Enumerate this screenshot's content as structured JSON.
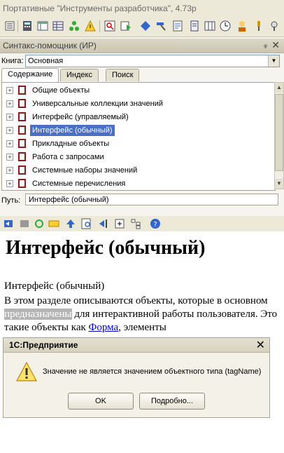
{
  "window": {
    "title": "Портативные \"Инструменты разработчика\", 4.73р"
  },
  "panel": {
    "title": "Синтакс-помощник (ИР)",
    "pin": "ᵩ",
    "close": "✕"
  },
  "book": {
    "label": "Книга:",
    "value": "Основная"
  },
  "tabs": [
    "Содержание",
    "Индекс",
    "Поиск"
  ],
  "tree": {
    "items": [
      {
        "label": "Общие объекты"
      },
      {
        "label": "Универсальные коллекции значений"
      },
      {
        "label": "Интерфейс (управляемый)"
      },
      {
        "label": "Интерфейс (обычный)",
        "selected": true
      },
      {
        "label": "Прикладные объекты"
      },
      {
        "label": "Работа с запросами"
      },
      {
        "label": "Системные наборы значений"
      },
      {
        "label": "Системные перечисления"
      }
    ]
  },
  "path": {
    "label": "Путь:",
    "value": "Интерфейс (обычный)"
  },
  "content": {
    "heading": "Интерфейс (обычный)",
    "subheading": "Интерфейс (обычный)",
    "para_before": "В этом разделе описываются объекты, которые в основном ",
    "para_highlight": "предназначены",
    "para_after": " для интерактивной работы пользователя. Это такие объекты как ",
    "link": "Форма",
    "para_end": ", элементы"
  },
  "dialog": {
    "title": "1С:Предприятие",
    "message": "Значение не является значением объектного типа (tagName)",
    "ok": "OK",
    "details": "Подробно..."
  }
}
